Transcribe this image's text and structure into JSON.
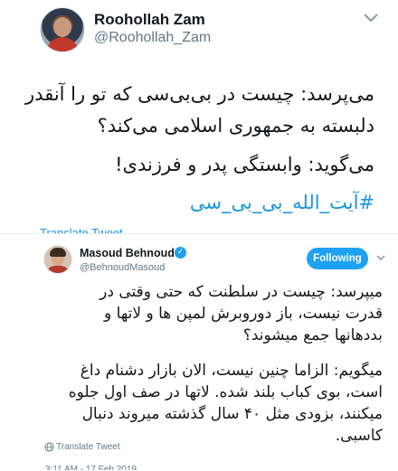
{
  "tweet1": {
    "author_name": "Roohollah Zam",
    "handle": "@Roohollah_Zam",
    "lines": [
      "می‌پرسد: چیست در بی‌بی‌سی که تو را آنقدر",
      "دلبسته به جمهوری اسلامی می‌کند؟",
      "می‌گوید: وابستگی پدر و فرزندی!"
    ],
    "hashtag": "#آیت_الله_بی_بی_سی",
    "translate_label": "Translate Tweet"
  },
  "tweet2": {
    "author_name": "Masoud Behnoud",
    "handle": "@BehnoudMasoud",
    "follow_label": "Following",
    "lines": [
      "میپرسد: چیست در سلطنت که حتی وقتی در",
      "قدرت نیست، باز دوروبرش لمپن ها و لاتها و",
      "بددهانها جمع میشوند؟",
      "میگویم: الزاما چنین نیست، الان بازار دشنام داغ",
      "است، بوی کباب بلند شده. لاتها در صف اول جلوه",
      "میکنند، بزودی مثل ۴۰ سال گذشته میروند دنبال",
      "کاسبی."
    ],
    "translate_label": "Translate Tweet",
    "timestamp": "3:11 AM - 17 Feb 2019"
  },
  "colors": {
    "link": "#1b95e0",
    "follow_button": "#1da1f2",
    "muted": "#657786"
  },
  "icons": [
    "chevron-down-icon",
    "verified-badge-icon",
    "globe-icon"
  ]
}
